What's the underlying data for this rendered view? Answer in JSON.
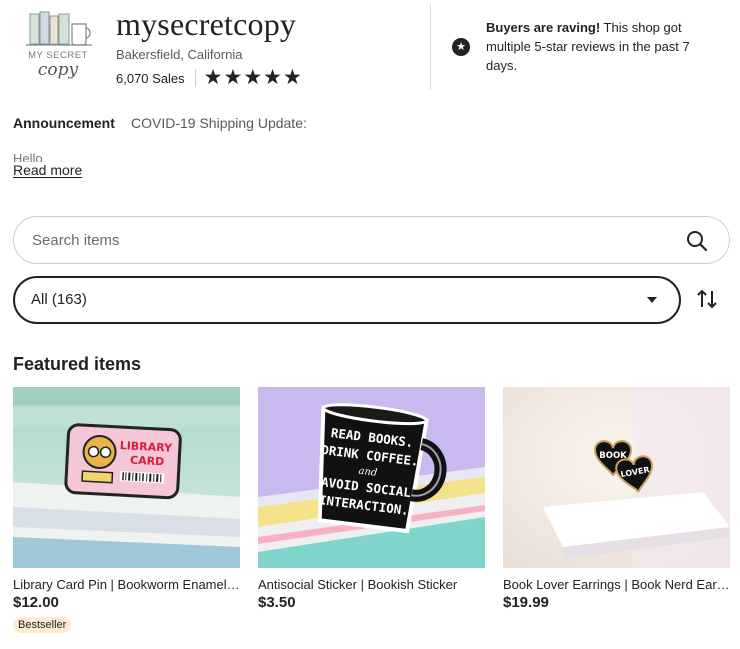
{
  "shop": {
    "name": "mysecretcopy",
    "location": "Bakersfield, California",
    "sales": "6,070 Sales",
    "rating_stars": 5,
    "logo": {
      "text_line1": "MY SECRET",
      "text_line2": "copy"
    }
  },
  "rave": {
    "bold": "Buyers are raving!",
    "text": " This shop got multiple 5-star reviews in the past 7 days.",
    "icon": "star-badge-icon"
  },
  "announcement": {
    "label": "Announcement",
    "text": "COVID-19 Shipping Update:",
    "body": "Hello",
    "read_more": "Read more"
  },
  "search": {
    "placeholder": "Search items",
    "icon": "search-icon"
  },
  "filter": {
    "selected": "All (163)",
    "sort_icon": "sort-icon"
  },
  "featured": {
    "title": "Featured items",
    "items": [
      {
        "title": "Library Card Pin | Bookworm Enamel Pin",
        "price": "$12.00",
        "badge": "Bestseller",
        "image_text": [
          "LIBRARY",
          "CARD"
        ]
      },
      {
        "title": "Antisocial Sticker | Bookish Sticker",
        "price": "$3.50",
        "badge": "",
        "image_text": [
          "READ BOOKS.",
          "DRINK COFFEE.",
          "and",
          "AVOID SOCIAL",
          "INTERACTION."
        ]
      },
      {
        "title": "Book Lover Earrings | Book Nerd Earrings",
        "price": "$19.99",
        "badge": "",
        "image_text": [
          "BOOK",
          "LOVER"
        ]
      }
    ]
  },
  "colors": {
    "text": "#222222",
    "muted": "#595959",
    "border": "#cfcfcf",
    "badge_bg": "#fdebd2"
  }
}
